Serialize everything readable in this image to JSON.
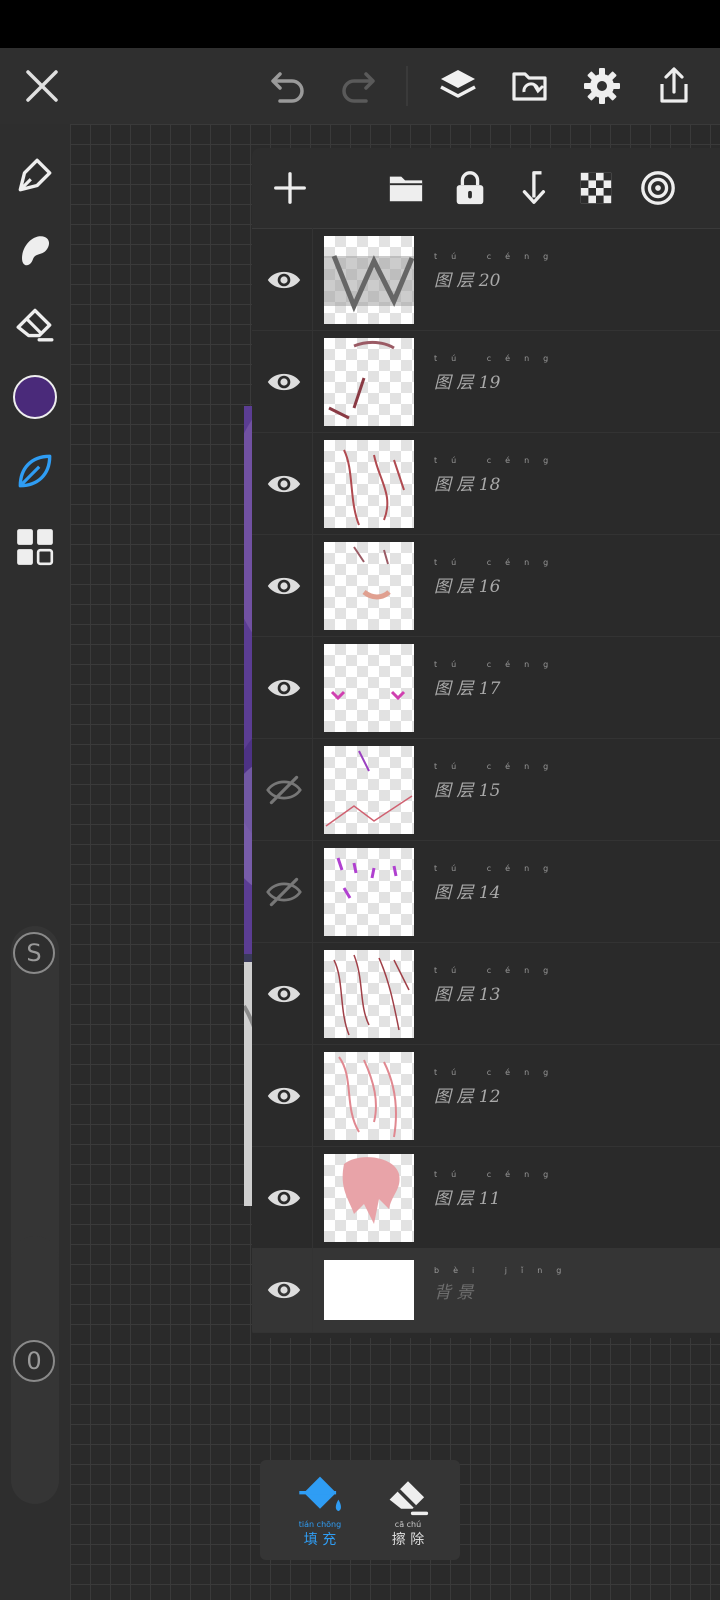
{
  "topbar": {
    "close": "close-icon",
    "undo": "undo-icon",
    "redo": "redo-icon",
    "layers": "layers-icon",
    "import": "folder-import-icon",
    "settings": "gear-icon",
    "share": "share-icon"
  },
  "tools": [
    "pen-icon",
    "smudge-icon",
    "eraser-icon",
    "color-swatch",
    "leaf-brush-icon",
    "grid-icon"
  ],
  "current_color": "#4a2a7a",
  "accent_color": "#2f9df4",
  "sliders": {
    "size_label": "S",
    "opacity_label": "0"
  },
  "layer_toolbar": [
    "add-icon",
    "folder-icon",
    "lock-icon",
    "merge-down-icon",
    "transparency-icon",
    "clipping-icon"
  ],
  "layers": [
    {
      "name": "图 层 20",
      "pinyin": "tú céng",
      "visible": true
    },
    {
      "name": "图 层 19",
      "pinyin": "tú céng",
      "visible": true
    },
    {
      "name": "图 层 18",
      "pinyin": "tú céng",
      "visible": true
    },
    {
      "name": "图 层 16",
      "pinyin": "tú céng",
      "visible": true
    },
    {
      "name": "图 层 17",
      "pinyin": "tú céng",
      "visible": true
    },
    {
      "name": "图 层 15",
      "pinyin": "tú céng",
      "visible": false
    },
    {
      "name": "图 层 14",
      "pinyin": "tú céng",
      "visible": false
    },
    {
      "name": "图 层 13",
      "pinyin": "tú céng",
      "visible": true
    },
    {
      "name": "图 层 12",
      "pinyin": "tú céng",
      "visible": true
    },
    {
      "name": "图 层 11",
      "pinyin": "tú céng",
      "visible": true
    },
    {
      "name": "背 景",
      "pinyin": "bèi jǐng",
      "visible": true
    }
  ],
  "bottom_tools": [
    {
      "label": "填 充",
      "pinyin": "tián chōng",
      "icon": "fill-bucket-icon",
      "active": true
    },
    {
      "label": "擦 除",
      "pinyin": "cā chú",
      "icon": "eraser-icon",
      "active": false
    }
  ]
}
